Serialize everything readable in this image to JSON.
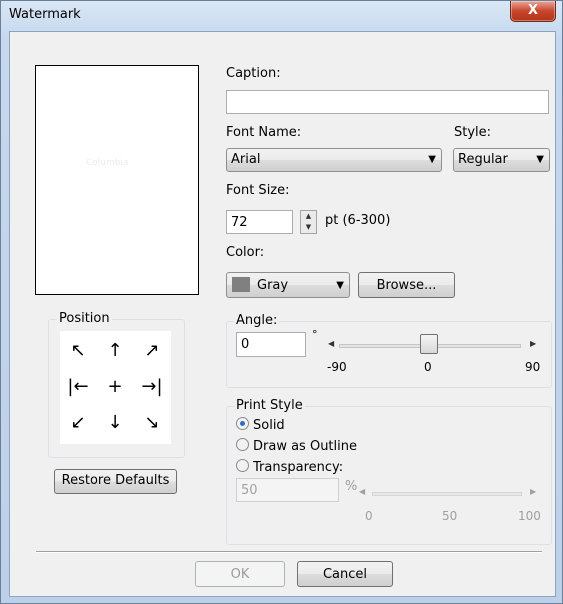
{
  "window": {
    "title": "Watermark",
    "close_glyph": "X"
  },
  "preview": {
    "sample_text": "Columbia"
  },
  "position": {
    "label": "Position",
    "arrows": [
      "↖",
      "↑",
      "↗",
      "|←",
      "+",
      "→|",
      "↙",
      "↓",
      "↘"
    ]
  },
  "caption": {
    "label": "Caption:",
    "value": ""
  },
  "font_name": {
    "label": "Font Name:",
    "value": "Arial"
  },
  "style": {
    "label": "Style:",
    "value": "Regular"
  },
  "font_size": {
    "label": "Font Size:",
    "value": "72",
    "range_text": "pt (6-300)"
  },
  "color": {
    "label": "Color:",
    "value": "Gray",
    "swatch_hex": "#808080",
    "browse_label": "Browse..."
  },
  "angle": {
    "label": "Angle:",
    "value": "0",
    "unit": "°",
    "min_label": "-90",
    "mid_label": "0",
    "max_label": "90",
    "level": 0
  },
  "print_style": {
    "label": "Print Style",
    "options": [
      "Solid",
      "Draw as Outline",
      "Transparency:"
    ],
    "selected": "Solid"
  },
  "transparency": {
    "value": "50",
    "unit": "%",
    "min_label": "0",
    "mid_label": "50",
    "max_label": "100"
  },
  "buttons": {
    "restore_defaults": "Restore Defaults",
    "ok": "OK",
    "cancel": "Cancel"
  }
}
